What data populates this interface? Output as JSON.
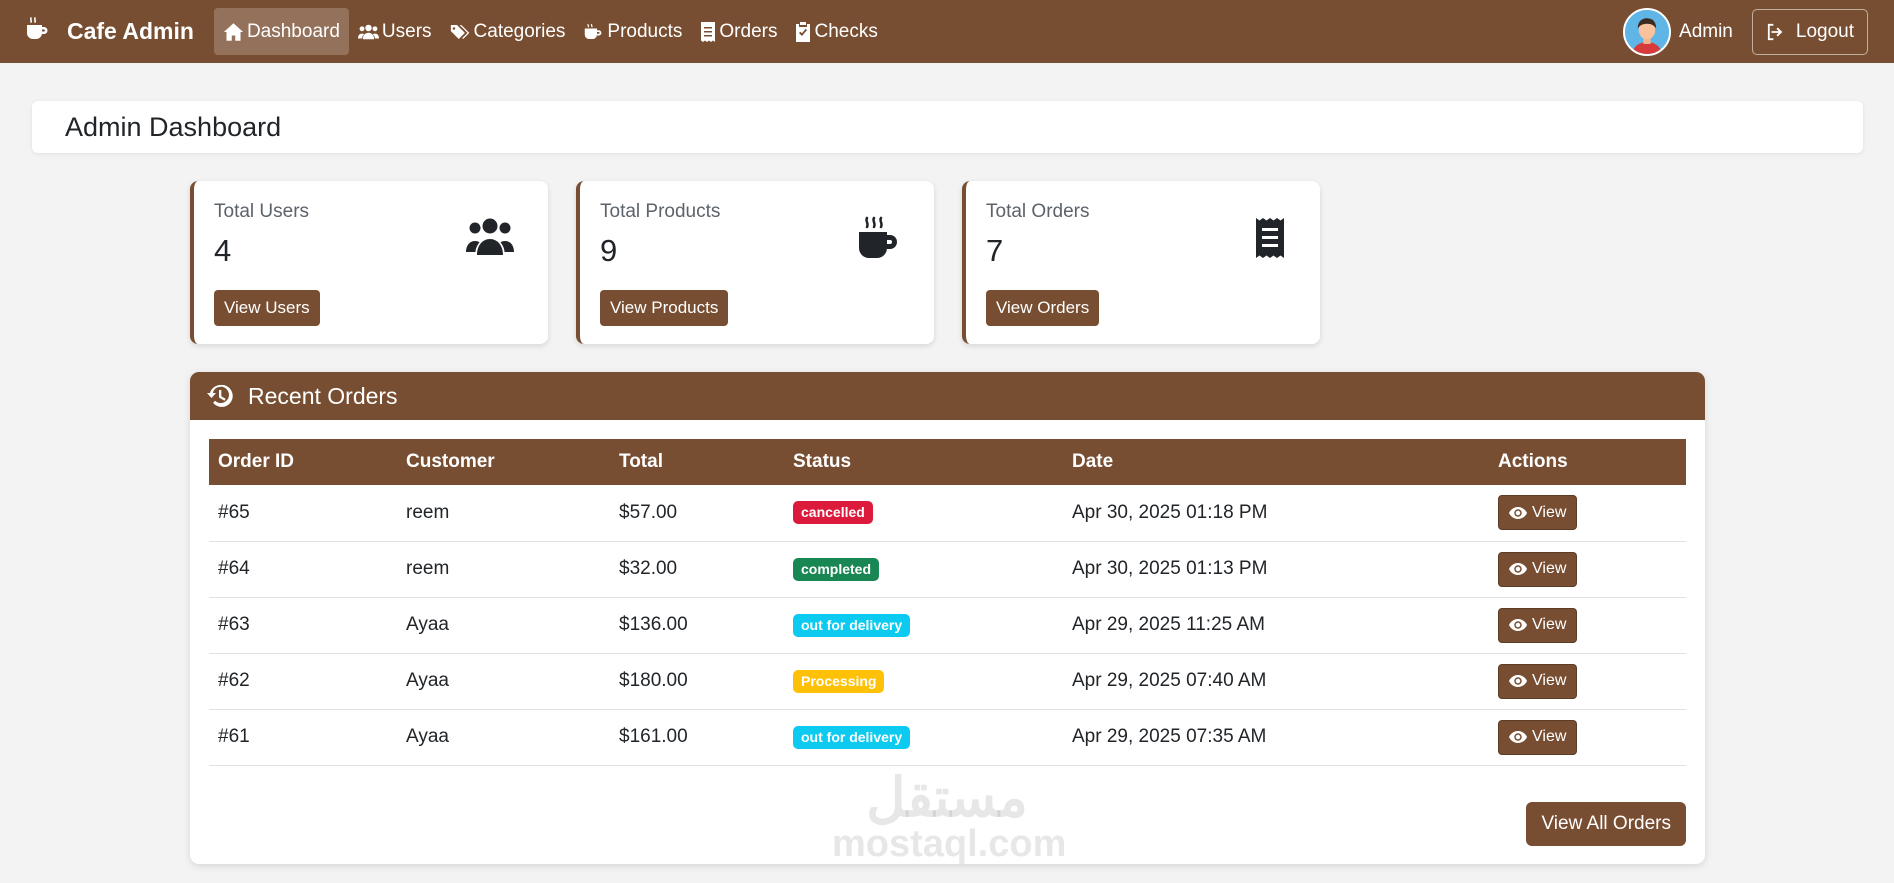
{
  "brand": {
    "name": "Cafe Admin",
    "icon": "coffee-cup-icon"
  },
  "nav": [
    {
      "label": "Dashboard",
      "icon": "home-icon",
      "active": true
    },
    {
      "label": "Users",
      "icon": "users-icon"
    },
    {
      "label": "Categories",
      "icon": "tags-icon"
    },
    {
      "label": "Products",
      "icon": "coffee-icon"
    },
    {
      "label": "Orders",
      "icon": "receipt-icon"
    },
    {
      "label": "Checks",
      "icon": "clipboard-check-icon"
    }
  ],
  "user": {
    "name": "Admin",
    "logout_label": "Logout"
  },
  "page": {
    "title": "Admin Dashboard"
  },
  "stats": [
    {
      "label": "Total Users",
      "value": "4",
      "button": "View Users",
      "icon": "users-icon"
    },
    {
      "label": "Total Products",
      "value": "9",
      "button": "View Products",
      "icon": "coffee-mug-icon"
    },
    {
      "label": "Total Orders",
      "value": "7",
      "button": "View Orders",
      "icon": "receipt-icon"
    }
  ],
  "recent_orders": {
    "title": "Recent Orders",
    "icon": "history-icon",
    "columns": [
      "Order ID",
      "Customer",
      "Total",
      "Status",
      "Date",
      "Actions"
    ],
    "rows": [
      {
        "id": "#65",
        "customer": "reem",
        "total": "$57.00",
        "status": "cancelled",
        "date": "Apr 30, 2025 01:18 PM",
        "action": "View"
      },
      {
        "id": "#64",
        "customer": "reem",
        "total": "$32.00",
        "status": "completed",
        "date": "Apr 30, 2025 01:13 PM",
        "action": "View"
      },
      {
        "id": "#63",
        "customer": "Ayaa",
        "total": "$136.00",
        "status": "out for delivery",
        "date": "Apr 29, 2025 11:25 AM",
        "action": "View"
      },
      {
        "id": "#62",
        "customer": "Ayaa",
        "total": "$180.00",
        "status": "Processing",
        "date": "Apr 29, 2025 07:40 AM",
        "action": "View"
      },
      {
        "id": "#61",
        "customer": "Ayaa",
        "total": "$161.00",
        "status": "out for delivery",
        "date": "Apr 29, 2025 07:35 AM",
        "action": "View"
      }
    ],
    "view_all_label": "View All Orders"
  },
  "status_colors": {
    "cancelled": "#dc1b3c",
    "completed": "#198754",
    "out for delivery": "#0dcaf0",
    "Processing": "#ffc107"
  },
  "theme": {
    "primary": "#784e32",
    "background": "#f3f3f3"
  },
  "watermark": {
    "arabic": "مستقل",
    "latin": "mostaql.com"
  }
}
